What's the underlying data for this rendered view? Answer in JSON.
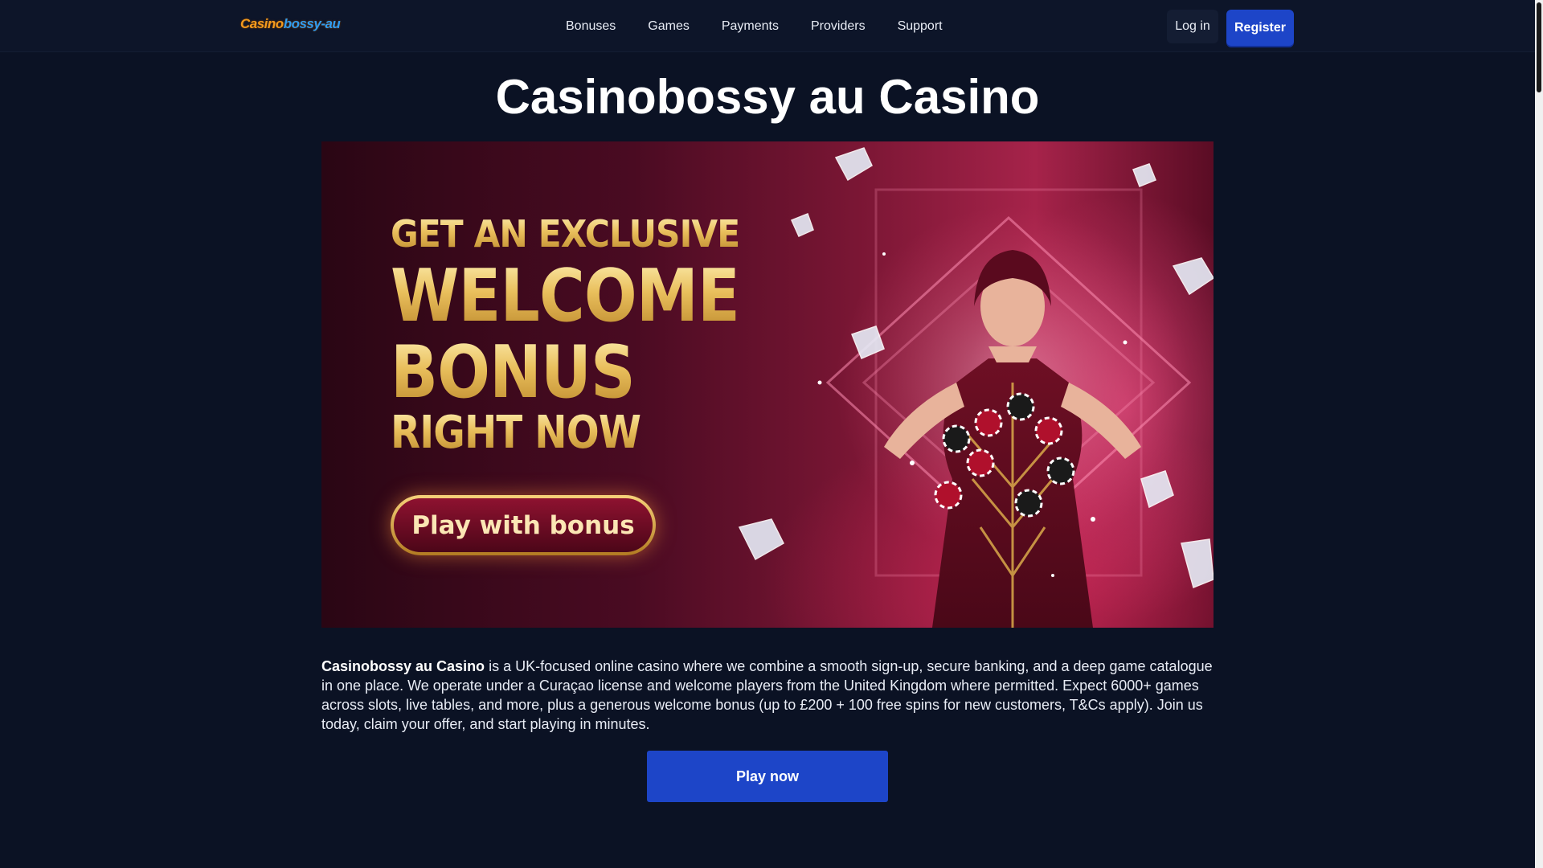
{
  "header": {
    "logo_part1": "Casino",
    "logo_part2": "bossy-au",
    "nav": [
      "Bonuses",
      "Games",
      "Payments",
      "Providers",
      "Support"
    ],
    "login_label": "Log in",
    "register_label": "Register"
  },
  "main": {
    "title": "Casinobossy au Casino",
    "banner": {
      "line1": "GET AN EXCLUSIVE",
      "line2": "WELCOME",
      "line3": "BONUS",
      "line4": "RIGHT NOW",
      "cta": "Play with bonus"
    },
    "intro_bold": "Casinobossy au Casino",
    "intro_text": " is a UK-focused online casino where we combine a smooth sign-up, secure banking, and a deep game catalogue in one place. We operate under a Curaçao license and welcome players from the United Kingdom where permitted. Expect 6000+ games across slots, live tables, and more, plus a generous welcome bonus (up to £200 + 100 free spins for new customers, T&Cs apply). Join us today, claim your offer, and start playing in minutes.",
    "play_now_label": "Play now"
  },
  "colors": {
    "background": "#0b1224",
    "header_bg": "#0d1529",
    "accent_blue": "#1d45c8",
    "logo_orange": "#f39a1e",
    "logo_blue": "#2f9bf0",
    "banner_gold": "#e9bf5c",
    "banner_red": "#7a1634"
  }
}
